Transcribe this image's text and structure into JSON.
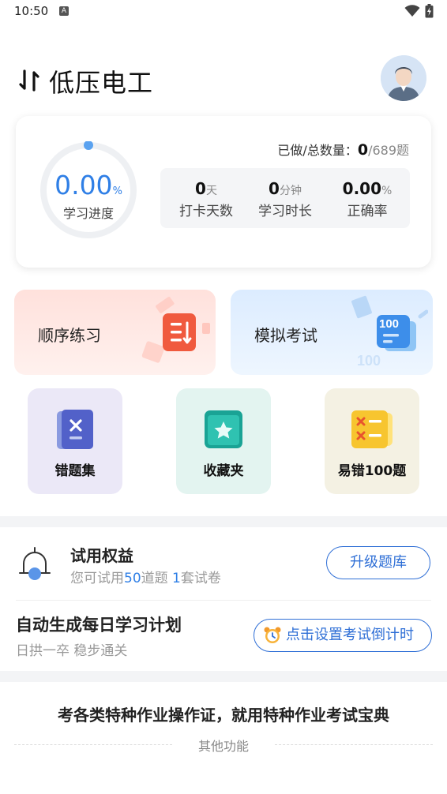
{
  "status_bar": {
    "time": "10:50",
    "notification_icon": "A"
  },
  "header": {
    "title": "低压电工",
    "switch_icon": "switch-arrows-icon",
    "avatar_icon": "user-avatar-icon"
  },
  "progress": {
    "percent_value": "0.00",
    "percent_unit": "%",
    "percent_fraction": 0.0,
    "label": "学习进度",
    "done_label": "已做/总数量：",
    "done_count": "0",
    "total": "/689题",
    "stats": [
      {
        "value": "0",
        "unit": "天",
        "label": "打卡天数"
      },
      {
        "value": "0",
        "unit": "分钟",
        "label": "学习时长"
      },
      {
        "value": "0.00",
        "unit": "%",
        "label": "正确率"
      }
    ]
  },
  "practice": {
    "sequential": {
      "label": "顺序练习",
      "icon": "document-list-icon"
    },
    "mock_exam": {
      "label": "模拟考试",
      "icon": "score-100-icon",
      "icon_text": "100",
      "watermark": "100"
    }
  },
  "tools": [
    {
      "label": "错题集",
      "icon": "wrong-book-icon"
    },
    {
      "label": "收藏夹",
      "icon": "star-folder-icon"
    },
    {
      "label": "易错100题",
      "icon": "error-100-icon"
    }
  ],
  "trial": {
    "title": "试用权益",
    "sub_prefix": "您可试用",
    "questions": "50",
    "sub_mid": "道题 ",
    "papers": "1",
    "sub_suffix": "套试卷",
    "button": "升级题库"
  },
  "plan": {
    "title": "自动生成每日学习计划",
    "subtitle": "日拱一卒 稳步通关",
    "button": "点击设置考试倒计时"
  },
  "footer": {
    "slogan": "考各类特种作业操作证，就用特种作业考试宝典",
    "other": "其他功能"
  },
  "colors": {
    "accent": "#2f7fe6",
    "button_border": "#2f6fd6"
  }
}
